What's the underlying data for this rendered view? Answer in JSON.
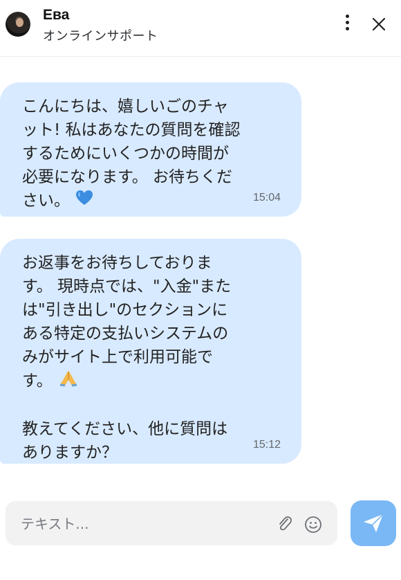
{
  "header": {
    "name": "Ева",
    "status": "オンラインサポート"
  },
  "messages": [
    {
      "text": "こんにちは、嬉しいごのチャット! 私はあなたの質問を確認するためにいくつかの時間が必要になります。 お待ちください。",
      "emoji": "blue-heart",
      "time": "15:04"
    },
    {
      "text": "お返事をお待ちしております。 現時点では、\"入金\"または\"引き出し\"のセクションにある特定の支払いシステムのみがサイト上で利用可能です。",
      "emoji": "folded-hands",
      "text2": "教えてください、他に質問はありますか？",
      "time": "15:12"
    }
  ],
  "composer": {
    "placeholder": "テキスト..."
  },
  "colors": {
    "bubble": "#d8eaff",
    "send_button": "#7ab8f5",
    "input_bg": "#f2f2f3"
  }
}
